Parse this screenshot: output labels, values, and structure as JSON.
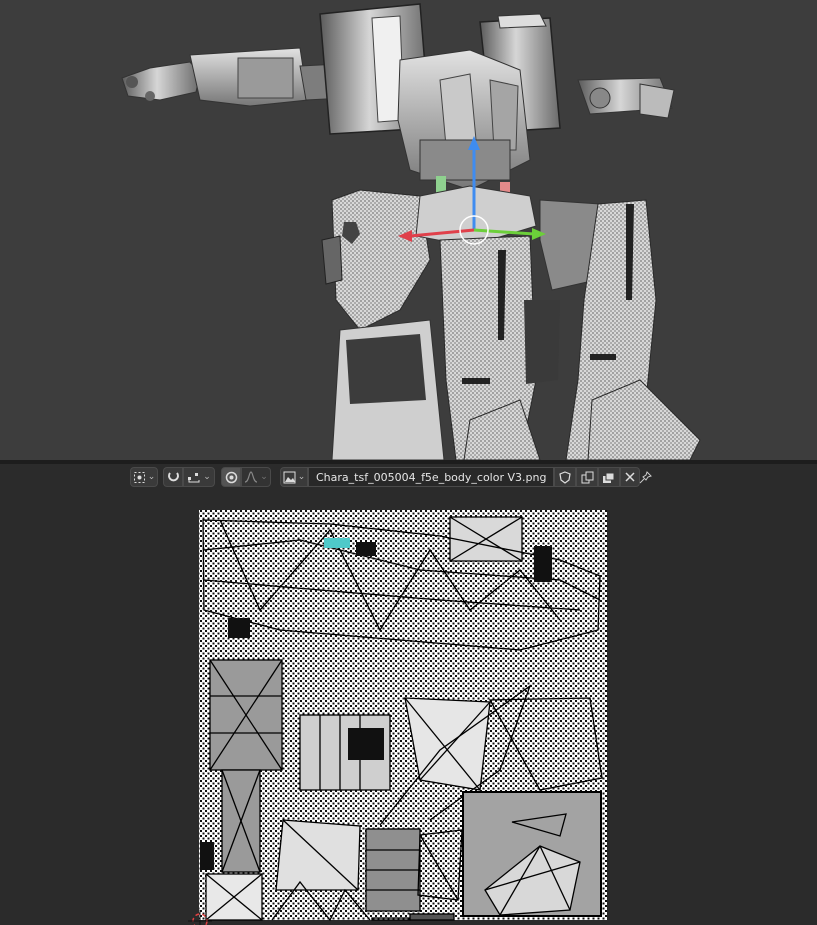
{
  "viewport_3d": {
    "view": "perspective",
    "background": "#3d3d3d",
    "gizmo": {
      "x_axis_color": "#e0404a",
      "y_axis_color": "#6ccf3a",
      "z_axis_color": "#3f8cf0"
    }
  },
  "uv_editor": {
    "header": {
      "pivot_icon": "pivot-point-icon",
      "snap_icon": "snap-magnet-icon",
      "snap_target_icon": "snap-target-icon",
      "proportional_icon": "proportional-edit-icon",
      "falloff_icon": "falloff-curve-icon",
      "browse_image_icon": "image-browse-icon",
      "image_name": "Chara_tsf_005004_f5e_body_color V3.png",
      "fake_user_icon": "shield-icon",
      "duplicate_icon": "duplicate-image-icon",
      "new_image_icon": "new-image-icon",
      "unlink_icon": "close-icon",
      "pin_icon": "pin-icon"
    },
    "canvas": {
      "background": "#2b2b2b",
      "texture_background": "#ffffff",
      "uv_wire_color": "#000000"
    }
  }
}
